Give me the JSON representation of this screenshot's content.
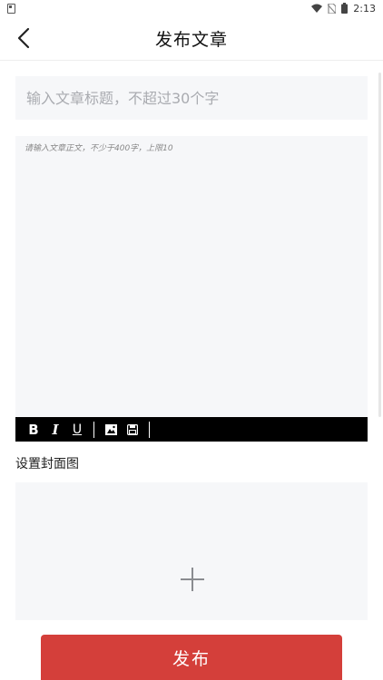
{
  "status_bar": {
    "time": "2:13",
    "icons": [
      "sim-card-icon",
      "wifi-icon",
      "no-sim-icon",
      "battery-icon"
    ]
  },
  "header": {
    "title": "发布文章",
    "back_icon": "chevron-left-icon"
  },
  "title_input": {
    "value": "",
    "placeholder": "输入文章标题，不超过30个字"
  },
  "body_editor": {
    "placeholder": "请输入文章正文，不少于400字，上限10"
  },
  "toolbar": {
    "bold": "B",
    "italic": "I",
    "underline": "U",
    "icons": [
      "image-icon",
      "save-icon"
    ]
  },
  "cover": {
    "label": "设置封面图",
    "add_icon": "plus-icon"
  },
  "publish_button": {
    "label": "发布",
    "color": "#d43f3a"
  },
  "colors": {
    "field_background": "#f6f7f9",
    "toolbar_background": "#000000",
    "placeholder": "#a9abb0"
  }
}
